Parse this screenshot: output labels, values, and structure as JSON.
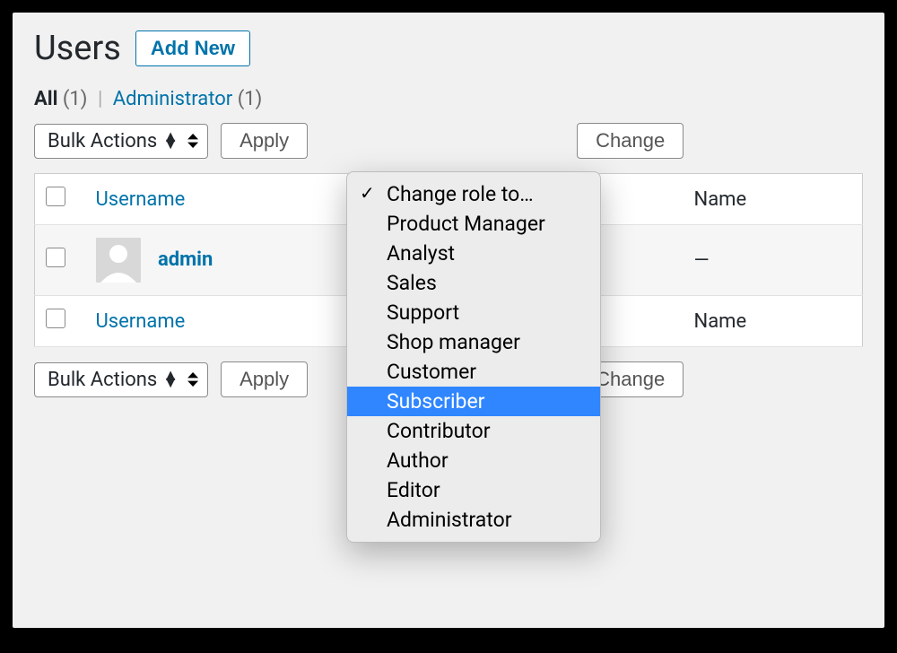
{
  "header": {
    "title": "Users",
    "add_new": "Add New"
  },
  "filters": {
    "all_label": "All",
    "all_count": "(1)",
    "sep": "|",
    "admin_label": "Administrator",
    "admin_count": "(1)"
  },
  "bulk": {
    "label": "Bulk Actions",
    "apply": "Apply",
    "change": "Change"
  },
  "dropdown": {
    "items": [
      "Change role to…",
      "Product Manager",
      "Analyst",
      "Sales",
      "Support",
      "Shop manager",
      "Customer",
      "Subscriber",
      "Contributor",
      "Author",
      "Editor",
      "Administrator"
    ],
    "checked_index": 0,
    "selected_index": 7
  },
  "table": {
    "col_username": "Username",
    "col_name": "Name",
    "rows": [
      {
        "username": "admin",
        "name": "—"
      }
    ]
  }
}
